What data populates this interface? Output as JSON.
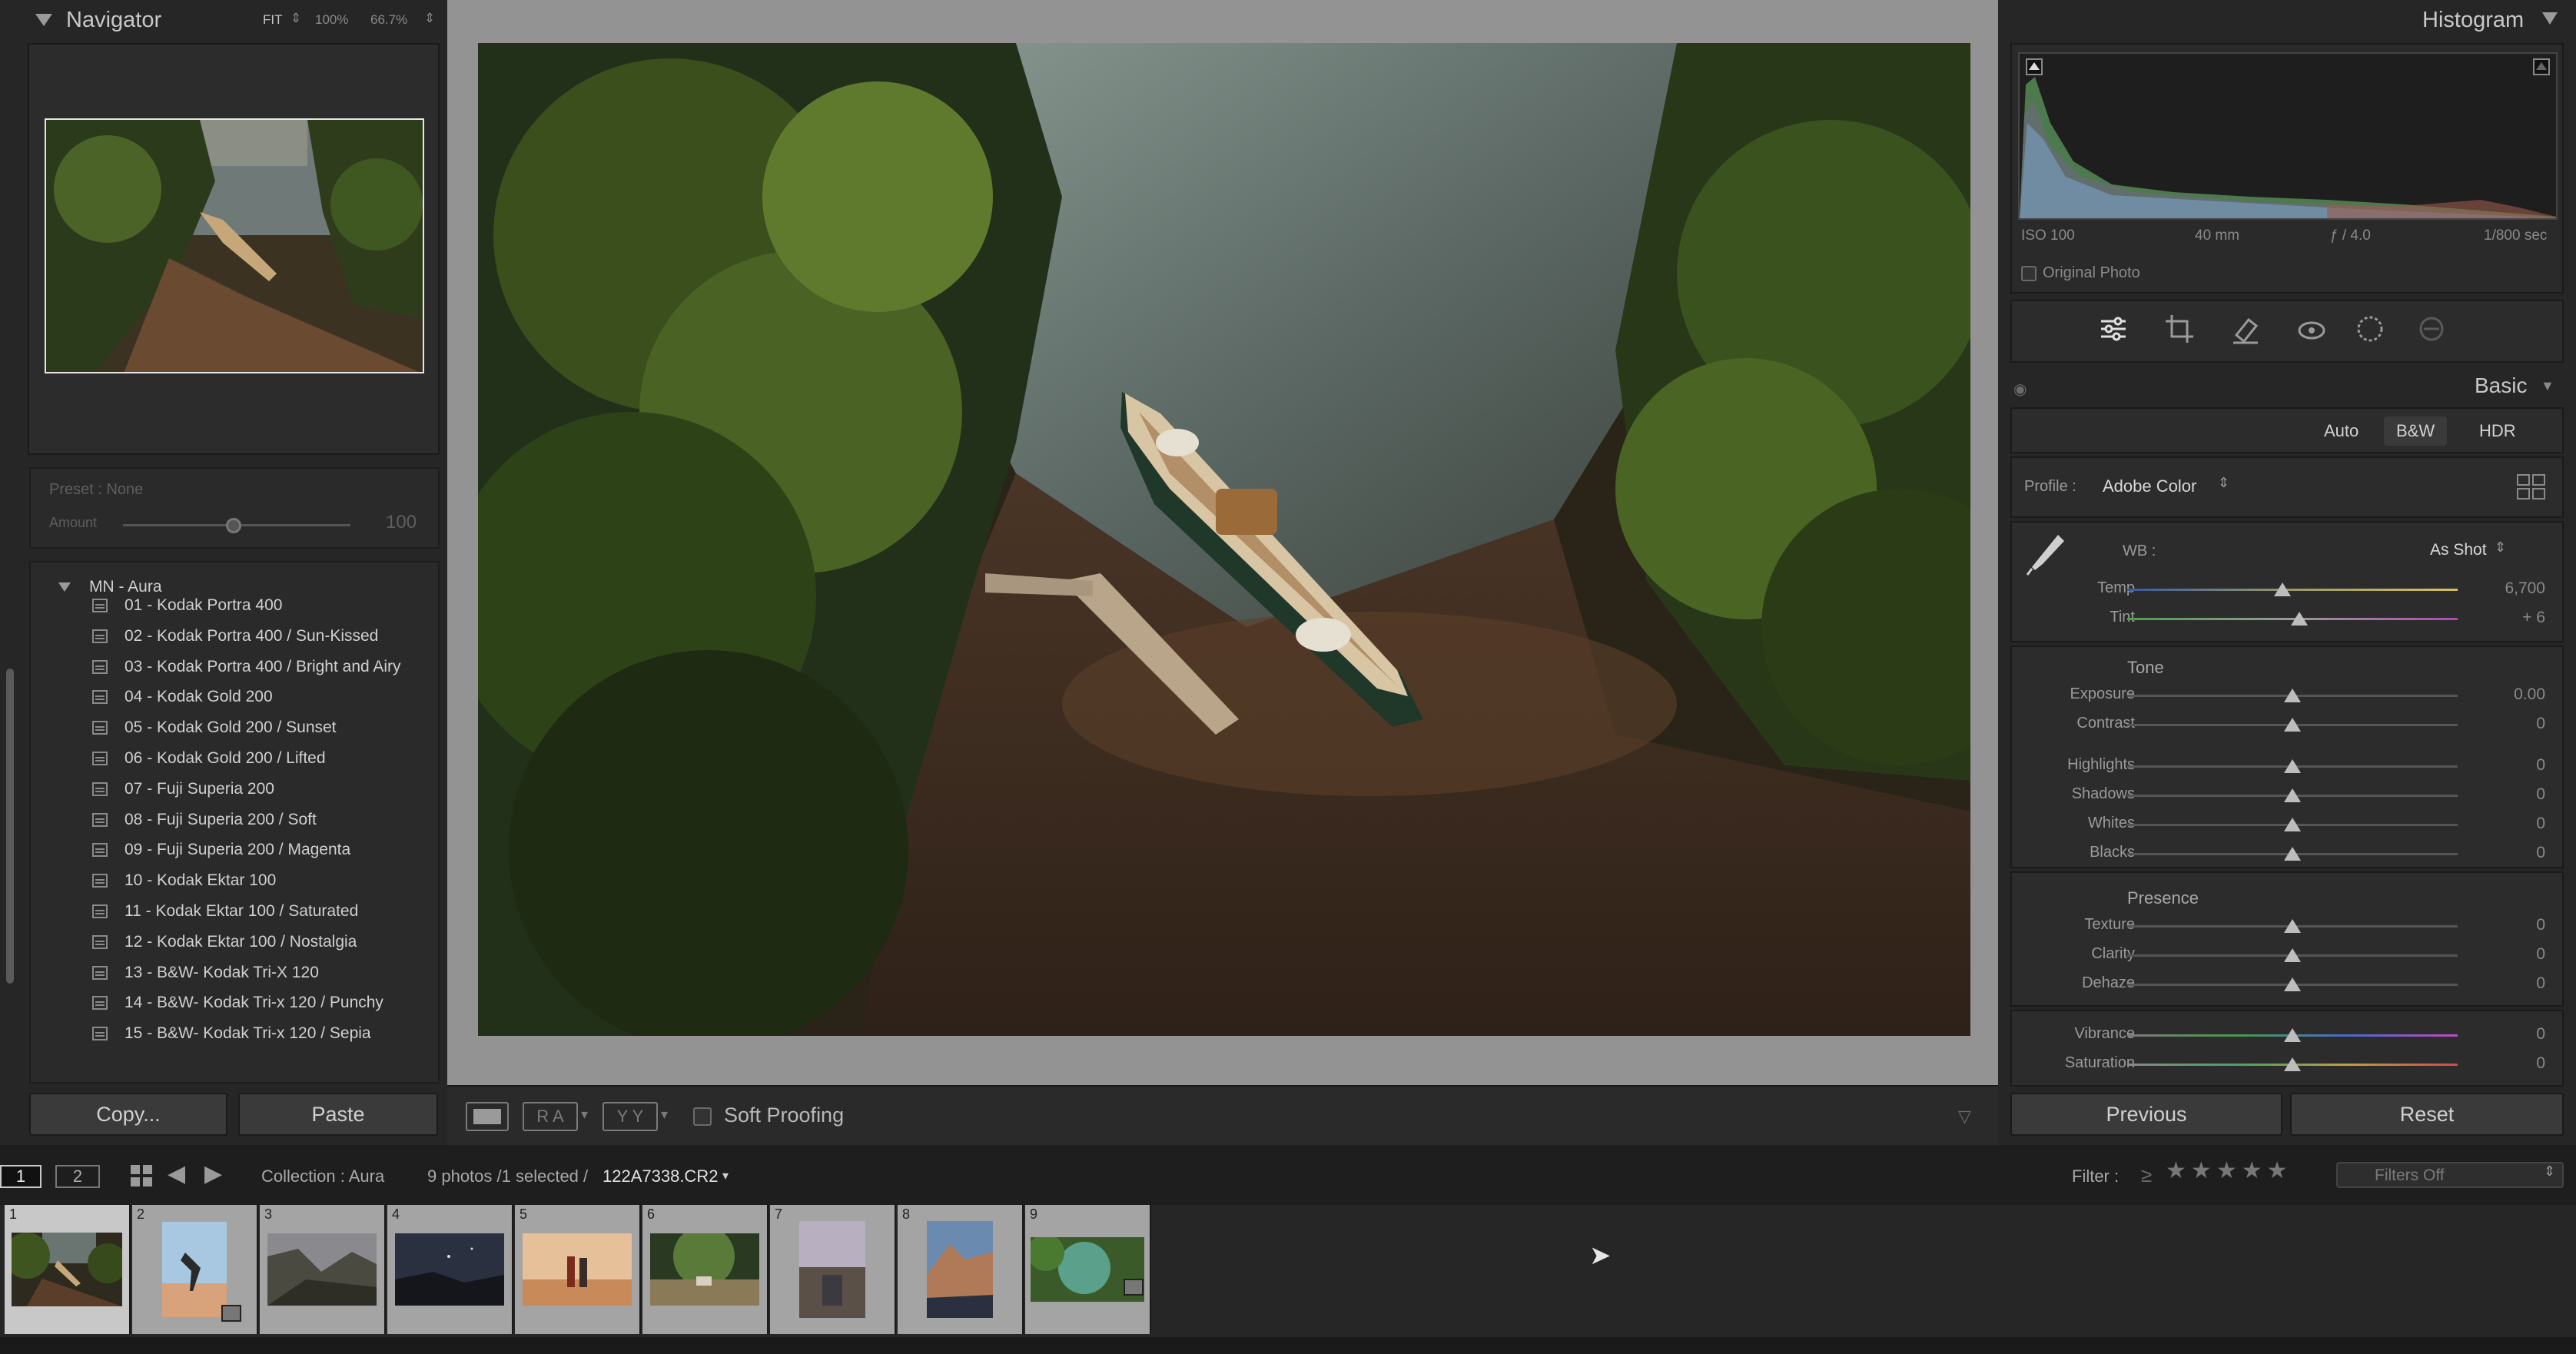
{
  "navigator": {
    "title": "Navigator",
    "zoom_fit": "FIT",
    "zoom_100": "100%",
    "zoom_66": "66.7%"
  },
  "preset_amount": {
    "preset_label": "Preset : None",
    "amount_label": "Amount",
    "amount_value": "100",
    "amount_fraction": 0.5
  },
  "presets": {
    "group": "MN - Aura",
    "items": [
      "01 - Kodak Portra 400",
      "02 - Kodak Portra 400 / Sun-Kissed",
      "03 - Kodak Portra 400 / Bright and Airy",
      "04 - Kodak Gold 200",
      "05 - Kodak Gold 200 / Sunset",
      "06 - Kodak Gold 200 / Lifted",
      "07 - Fuji Superia 200",
      "08 - Fuji Superia 200 / Soft",
      "09 - Fuji Superia 200 / Magenta",
      "10 - Kodak Ektar 100",
      "11 - Kodak Ektar 100 / Saturated",
      "12 - Kodak Ektar 100 / Nostalgia",
      "13 - B&W- Kodak Tri-X 120",
      "14 - B&W- Kodak Tri-x 120 / Punchy",
      "15 - B&W- Kodak Tri-x 120 / Sepia"
    ]
  },
  "left_buttons": {
    "copy": "Copy...",
    "paste": "Paste"
  },
  "toolbar": {
    "soft_proofing": "Soft Proofing",
    "ra": "R A",
    "yy": "Y Y"
  },
  "histogram": {
    "title": "Histogram",
    "iso": "ISO 100",
    "focal": "40 mm",
    "aperture": "ƒ / 4.0",
    "shutter": "1/800 sec",
    "original_photo": "Original Photo"
  },
  "basic": {
    "title": "Basic",
    "auto": "Auto",
    "bw": "B&W",
    "hdr": "HDR",
    "profile_label": "Profile :",
    "profile_value": "Adobe Color",
    "wb_label": "WB :",
    "wb_value": "As Shot",
    "tone_label": "Tone",
    "presence_label": "Presence",
    "sliders": [
      {
        "label": "Temp",
        "value": "6,700",
        "pos": 0.47
      },
      {
        "label": "Tint",
        "value": "+ 6",
        "pos": 0.52
      },
      {
        "label": "Exposure",
        "value": "0.00",
        "pos": 0.5
      },
      {
        "label": "Contrast",
        "value": "0",
        "pos": 0.5
      },
      {
        "label": "Highlights",
        "value": "0",
        "pos": 0.5
      },
      {
        "label": "Shadows",
        "value": "0",
        "pos": 0.5
      },
      {
        "label": "Whites",
        "value": "0",
        "pos": 0.5
      },
      {
        "label": "Blacks",
        "value": "0",
        "pos": 0.5
      },
      {
        "label": "Texture",
        "value": "0",
        "pos": 0.5
      },
      {
        "label": "Clarity",
        "value": "0",
        "pos": 0.5
      },
      {
        "label": "Dehaze",
        "value": "0",
        "pos": 0.5
      },
      {
        "label": "Vibrance",
        "value": "0",
        "pos": 0.5
      },
      {
        "label": "Saturation",
        "value": "0",
        "pos": 0.5
      }
    ]
  },
  "right_buttons": {
    "previous": "Previous",
    "reset": "Reset"
  },
  "filmbar": {
    "screen1": "1",
    "screen2": "2",
    "collection": "Collection : Aura",
    "count": "9 photos /1 selected /",
    "filename": "122A7338.CR2",
    "filter_label": "Filter :",
    "filter_op": "≥",
    "filters_value": "Filters Off"
  },
  "filmstrip": {
    "numbers": [
      "1",
      "2",
      "3",
      "4",
      "5",
      "6",
      "7",
      "8",
      "9"
    ]
  },
  "colors": {
    "panel": "#262626",
    "center_bg": "#939393",
    "selected_cell": "#c8c8c8"
  }
}
